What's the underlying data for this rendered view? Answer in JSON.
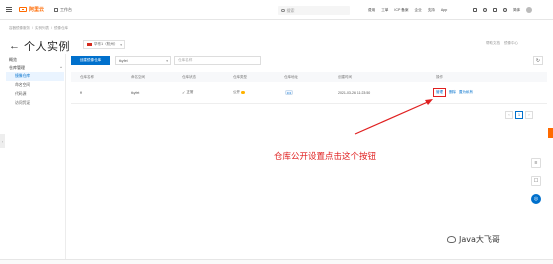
{
  "topbar": {
    "brand": "阿里云",
    "workbench": "工作台",
    "search_placeholder": "搜索",
    "nav": [
      "费用",
      "工单",
      "ICP 备案",
      "企业",
      "支持",
      "App"
    ],
    "lang": "简体"
  },
  "breadcrumb": [
    "容器镜像服务",
    "实例列表",
    "镜像仓库"
  ],
  "page": {
    "back_icon": "←",
    "title": "个人实例",
    "region": "华东1（杭州）",
    "top_links": [
      "帮助文档",
      "镜像中心"
    ]
  },
  "sidebar": {
    "overview": "概览",
    "group_label": "仓库管理",
    "group_chevron": "^",
    "items": [
      {
        "label": "镜像仓库",
        "active": true
      },
      {
        "label": "命名空间",
        "active": false
      },
      {
        "label": "代码源",
        "active": false
      },
      {
        "label": "访问凭证",
        "active": false
      }
    ],
    "collapse_icon": "‹"
  },
  "toolbar": {
    "create_label": "创建镜像仓库",
    "namespace": "tkyfet",
    "search_placeholder": "仓库名称",
    "refresh_icon": "↻"
  },
  "table": {
    "headers": [
      "仓库名称",
      "命名空间",
      "仓库状态",
      "仓库类型",
      "仓库地址",
      "创建时间",
      "操作"
    ],
    "rows": [
      {
        "name": "ff",
        "namespace": "tkyfet",
        "status": "正常",
        "type": "公开",
        "address_icon": "•••",
        "created": "2021-03-26 11:23:50",
        "actions": [
          "管理",
          "删除",
          "置为私有"
        ]
      }
    ]
  },
  "pager": {
    "prev": "‹",
    "current": "1",
    "next": "›"
  },
  "annotation": "仓库公开设置点击这个按钮",
  "watermark": "Java大飞哥",
  "colors": {
    "accent": "#0070cc",
    "brand": "#ff6a00",
    "annotation": "#e02020"
  }
}
